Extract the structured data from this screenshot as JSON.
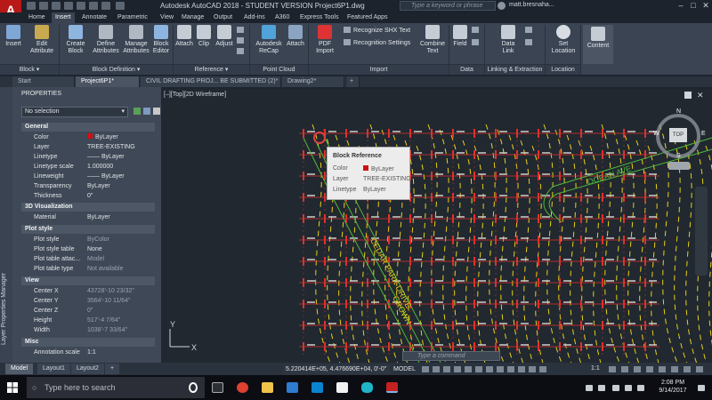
{
  "titlebar": {
    "app_logo": "A",
    "title": "Autodesk AutoCAD 2018 - STUDENT VERSION    Project6P1.dwg",
    "search_placeholder": "Type a keyword or phrase",
    "user": "matt.bresnaha..."
  },
  "ribbon_tabs": [
    "Home",
    "Insert",
    "Annotate",
    "Parametric",
    "View",
    "Manage",
    "Output",
    "Add-ins",
    "A360",
    "Express Tools",
    "Featured Apps"
  ],
  "ribbon_active_tab": "Insert",
  "ribbon": {
    "insert": "Insert",
    "edit_attribute": "Edit\nAttribute",
    "create_block": "Create\nBlock",
    "define_attributes": "Define\nAttributes",
    "manage_attributes": "Manage\nAttributes",
    "block_editor": "Block\nEditor",
    "attach": "Attach",
    "clip": "Clip",
    "adjust": "Adjust",
    "autodesk_recap": "Autodesk\nReCap",
    "attach_pc": "Attach",
    "pdf_import": "PDF\nImport",
    "recognize_shx": "Recognize SHX Text",
    "recognition_settings": "Recognition Settings",
    "combine_text": "Combine\nText",
    "field": "Field",
    "data_link": "Data\nLink",
    "set_location": "Set\nLocation",
    "content": "Content",
    "panels": [
      "Block ▾",
      "Block Definition ▾",
      "Reference ▾",
      "Point Cloud",
      "Import",
      "Data",
      "Linking & Extraction",
      "Location"
    ]
  },
  "file_tabs": [
    "Start",
    "Project6P1*",
    "CIVIL DRAFTING PROJ... BE SUBMITTED (2)*",
    "Drawing2*",
    "+"
  ],
  "file_tab_active": "Project6P1*",
  "properties": {
    "strip_label": "Layer Properties Manager",
    "title": "PROPERTIES",
    "selection": "No selection",
    "sections": [
      {
        "name": "General",
        "rows": [
          [
            "Color",
            "ByLayer",
            false
          ],
          [
            "Layer",
            "TREE-EXISTING",
            false
          ],
          [
            "Linetype",
            "—— ByLayer",
            false
          ],
          [
            "Linetype scale",
            "1.000000",
            false
          ],
          [
            "Lineweight",
            "—— ByLayer",
            false
          ],
          [
            "Transparency",
            "ByLayer",
            false
          ],
          [
            "Thickness",
            "0\"",
            false
          ]
        ]
      },
      {
        "name": "3D Visualization",
        "rows": [
          [
            "Material",
            "ByLayer",
            false
          ]
        ]
      },
      {
        "name": "Plot style",
        "rows": [
          [
            "Plot style",
            "ByColor",
            true
          ],
          [
            "Plot style table",
            "None",
            false
          ],
          [
            "Plot table attac...",
            "Model",
            true
          ],
          [
            "Plot table type",
            "Not available",
            true
          ]
        ]
      },
      {
        "name": "View",
        "rows": [
          [
            "Center X",
            "43728'-10 23/32\"",
            true
          ],
          [
            "Center Y",
            "3564'-10 11/64\"",
            true
          ],
          [
            "Center Z",
            "0\"",
            true
          ],
          [
            "Height",
            "517'-4 7/64\"",
            true
          ],
          [
            "Width",
            "1038'-7 33/64\"",
            true
          ]
        ]
      },
      {
        "name": "Misc",
        "rows": [
          [
            "Annotation scale",
            "1:1",
            false
          ]
        ]
      }
    ]
  },
  "viewport": {
    "label": "[–][Top][2D Wireframe]",
    "viewcube": {
      "top": "TOP",
      "n": "N",
      "s": "S",
      "w": "W",
      "e": "E"
    },
    "street_labels": [
      "OCEAN AVE",
      "CEDAR PARK DRIVE",
      "CROWN"
    ],
    "ucs": {
      "x": "X",
      "y": "Y"
    }
  },
  "tooltip": {
    "title": "Block Reference",
    "rows": [
      [
        "Color",
        "ByLayer"
      ],
      [
        "Layer",
        "TREE-EXISTING"
      ],
      [
        "Linetype",
        "ByLayer"
      ]
    ]
  },
  "layout_tabs": [
    "Model",
    "Layout1",
    "Layout2",
    "+"
  ],
  "layout_active": "Model",
  "status": {
    "coordinates": "5.220414E+05, 4.476690E+04, 0'-0\"",
    "space": "MODEL",
    "command_placeholder": "Type a command",
    "scale": "1:1"
  },
  "taskbar": {
    "search": "Type here to search",
    "time": "2:08 PM",
    "date": "9/14/2017"
  },
  "colors": {
    "accent": "#b81818",
    "grid_red": "#e0302c",
    "contour_yellow": "#e8d21a",
    "road_green": "#4fb83a"
  }
}
